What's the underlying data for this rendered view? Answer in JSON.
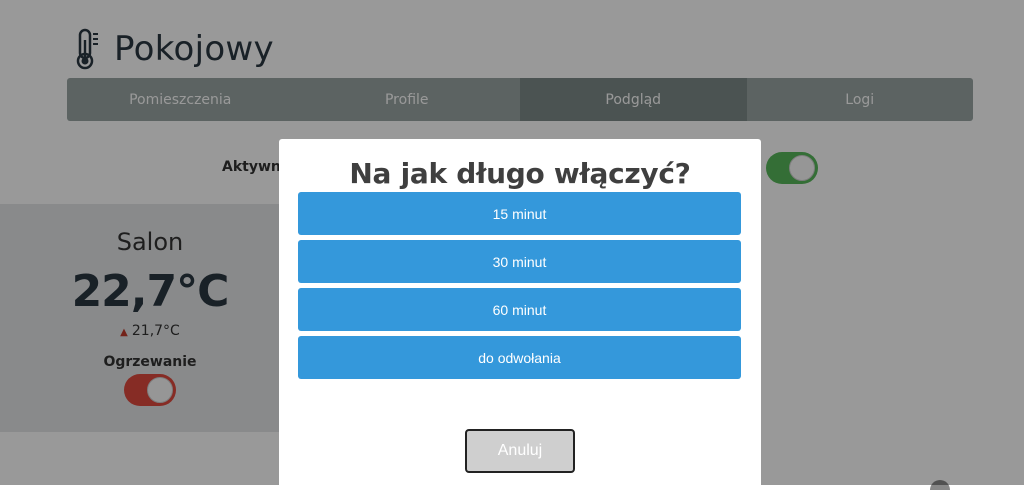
{
  "header": {
    "title": "Pokojowy",
    "icon": "thermometer-icon"
  },
  "nav": {
    "tabs": [
      {
        "label": "Pomieszczenia"
      },
      {
        "label": "Profile"
      },
      {
        "label": "Podgląd",
        "active": true
      },
      {
        "label": "Logi"
      }
    ]
  },
  "status": {
    "active_label": "Aktywny",
    "active_on": true
  },
  "room_card": {
    "name": "Salon",
    "temperature": "22,7°C",
    "target": "21,7°C",
    "heating_label": "Ogrzewanie",
    "heating_on": true
  },
  "modal": {
    "title": "Na jak długo włączyć?",
    "options": [
      "15 minut",
      "30 minut",
      "60 minut",
      "do odwołania"
    ],
    "cancel_label": "Anuluj"
  },
  "colors": {
    "accent": "#3498db",
    "toggle_on": "#57b85a",
    "heating_on": "#e04a3f"
  }
}
